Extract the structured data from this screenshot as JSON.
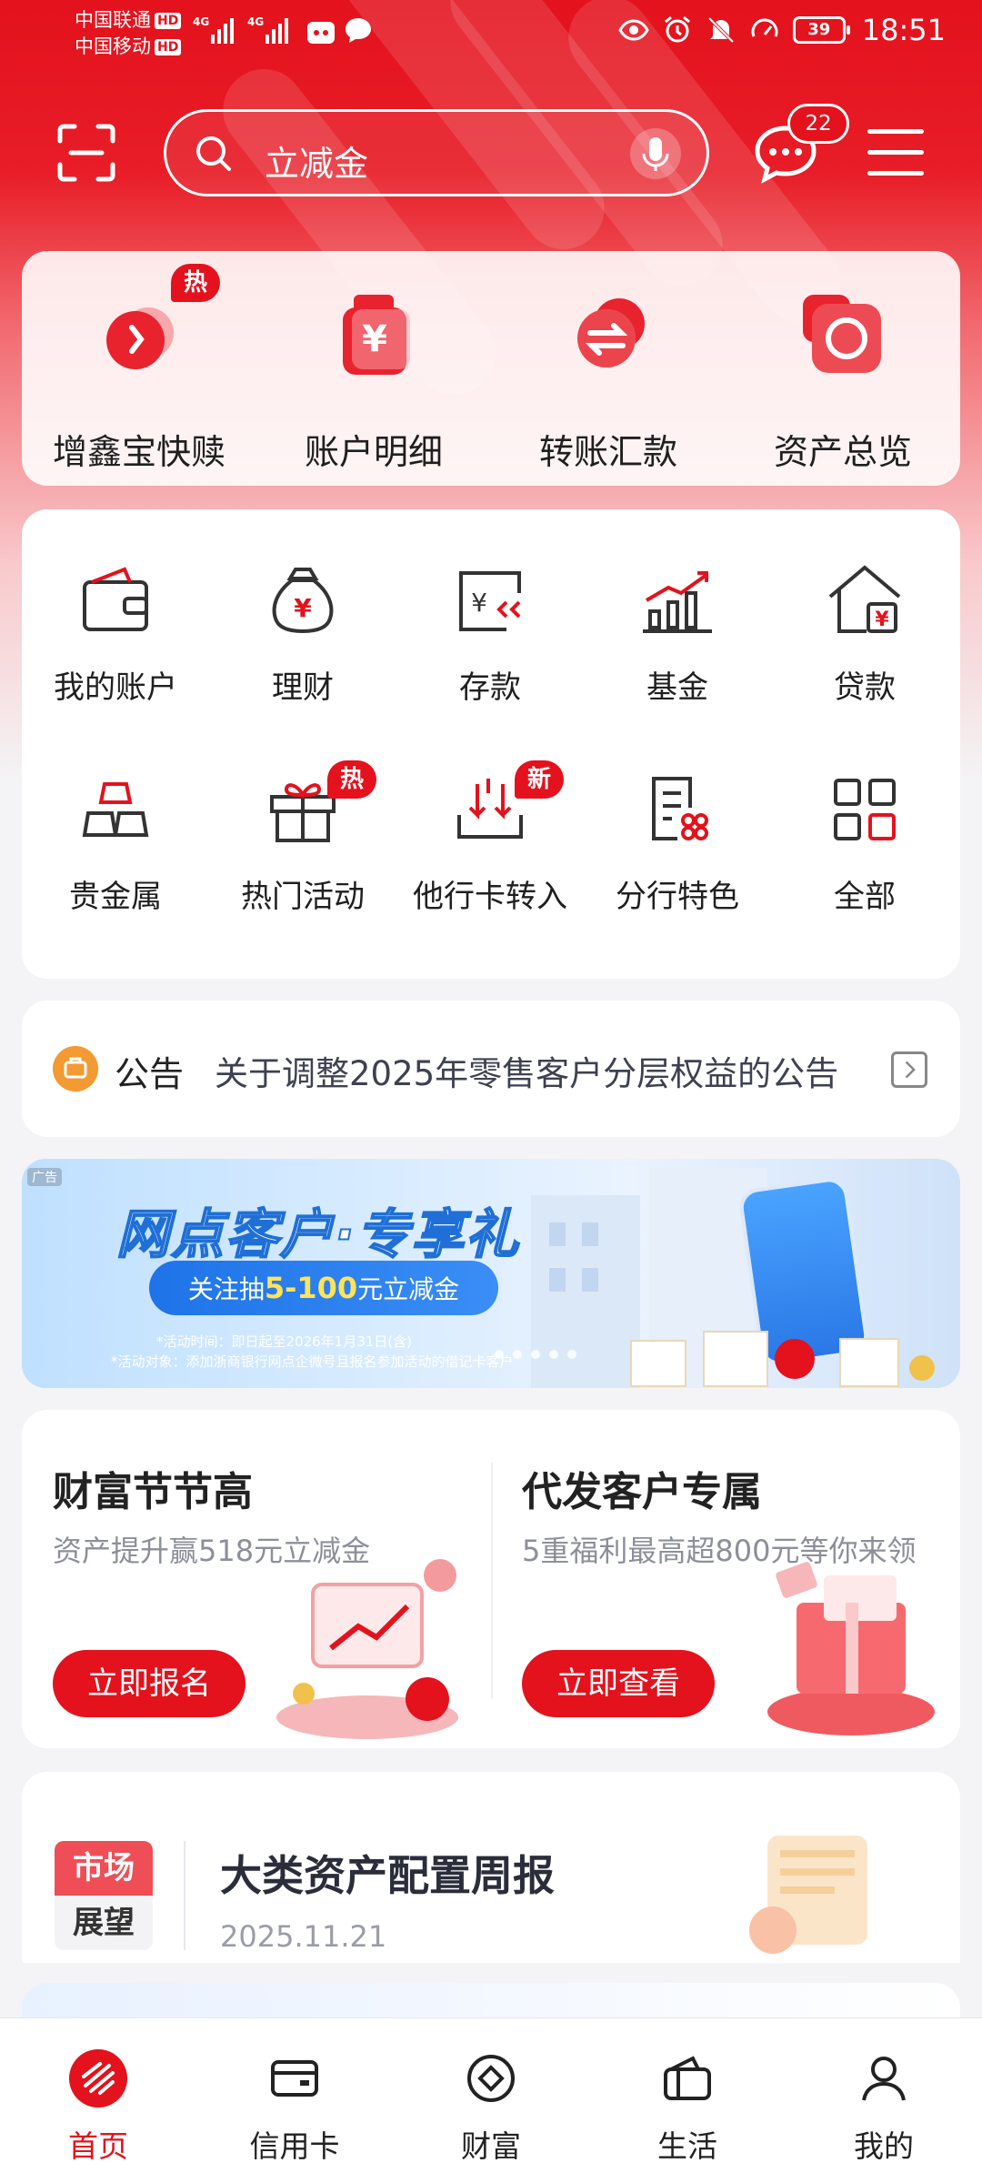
{
  "status_bar": {
    "carrier_1": "中国联通",
    "carrier_2": "中国移动",
    "hd": "HD",
    "network_1": "4G",
    "network_2": "4G",
    "battery": "39",
    "time": "18:51"
  },
  "header": {
    "search_placeholder": "立减金",
    "message_count": "22"
  },
  "quick_actions": [
    {
      "label": "增鑫宝快赎",
      "icon": "swap-coin-icon",
      "badge": "热"
    },
    {
      "label": "账户明细",
      "icon": "yuan-bag-icon"
    },
    {
      "label": "转账汇款",
      "icon": "transfer-arrows-icon"
    },
    {
      "label": "资产总览",
      "icon": "pie-chart-icon"
    }
  ],
  "services": [
    {
      "label": "我的账户",
      "icon": "wallet-icon"
    },
    {
      "label": "理财",
      "icon": "money-bag-icon"
    },
    {
      "label": "存款",
      "icon": "deposit-icon"
    },
    {
      "label": "基金",
      "icon": "bar-chart-icon"
    },
    {
      "label": "贷款",
      "icon": "house-loan-icon"
    },
    {
      "label": "贵金属",
      "icon": "gold-bars-icon"
    },
    {
      "label": "热门活动",
      "icon": "gift-icon",
      "badge": "热"
    },
    {
      "label": "他行卡转入",
      "icon": "card-inbound-icon",
      "badge": "新"
    },
    {
      "label": "分行特色",
      "icon": "branch-doc-icon"
    },
    {
      "label": "全部",
      "icon": "grid-all-icon"
    }
  ],
  "notice": {
    "tag": "公告",
    "text": "关于调整2025年零售客户分层权益的公告"
  },
  "banner": {
    "ad_label": "广告",
    "title": "网点客户·专享礼",
    "pill_prefix": "关注抽",
    "pill_highlight": "5-100",
    "pill_suffix": "元立减金",
    "note_1": "*活动时间：即日起至2026年1月31日(含)",
    "note_2": "*活动对象：添加浙商银行网点企微号且报名参加活动的借记卡客户"
  },
  "promos": [
    {
      "title": "财富节节高",
      "subtitle": "资产提升赢518元立减金",
      "button": "立即报名"
    },
    {
      "title": "代发客户专属",
      "subtitle": "5重福利最高超800元等你来领",
      "button": "立即查看"
    }
  ],
  "market": {
    "tag_line_1": "市场",
    "tag_line_2": "展望",
    "title": "大类资产配置周报",
    "date": "2025.11.21"
  },
  "tabs": [
    {
      "label": "首页",
      "icon": "home-logo-icon",
      "active": true
    },
    {
      "label": "信用卡",
      "icon": "credit-card-icon"
    },
    {
      "label": "财富",
      "icon": "wealth-diamond-icon"
    },
    {
      "label": "生活",
      "icon": "life-wallet-icon"
    },
    {
      "label": "我的",
      "icon": "profile-icon"
    }
  ],
  "colors": {
    "brand_red": "#e3121d",
    "badge_red": "#e3121d",
    "notice_orange": "#f39a33",
    "banner_blue": "#1e73e8"
  }
}
